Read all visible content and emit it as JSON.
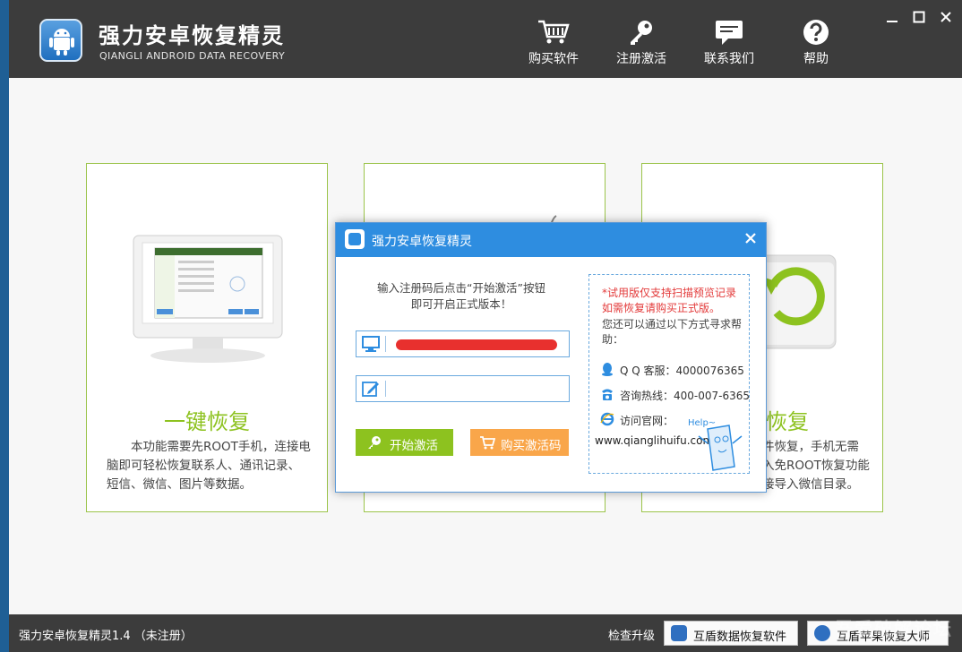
{
  "app": {
    "title": "强力安卓恢复精灵",
    "subtitle": "QIANGLI ANDROID DATA RECOVERY"
  },
  "nav": [
    {
      "label": "购买软件",
      "icon": "cart-icon"
    },
    {
      "label": "注册激活",
      "icon": "key-icon"
    },
    {
      "label": "联系我们",
      "icon": "chat-icon"
    },
    {
      "label": "帮助",
      "icon": "question-icon"
    }
  ],
  "cards": {
    "left": {
      "title": "一键恢复",
      "desc": "本功能需要先ROOT手机，连接电脑即可轻松恢复联系人、通讯记录、短信、微信、图片等数据。"
    },
    "right": {
      "title_visible": "恢复",
      "desc_lines": [
        "件恢复，手机无需",
        "入免ROOT恢复功能",
        "接导入微信目录。"
      ]
    }
  },
  "dialog": {
    "title": "强力安卓恢复精灵",
    "instruction_line1": "输入注册码后点击“开始激活”按钮",
    "instruction_line2": "即可开启正式版本！",
    "activate_label": "开始激活",
    "buy_label": "购买激活码",
    "help_red": "*试用版仅支持扫描预览记录如需恢复请购买正式版。",
    "help_normal": "您还可以通过以下方式寻求帮助：",
    "qq": "Q Q 客服：4000076365",
    "phone": "咨询热线：400-007-6365",
    "site_label": "访问官网：",
    "url": "www.qianglihuifu.com",
    "mascot_text": "Help~"
  },
  "statusbar": {
    "status": "强力安卓恢复精灵1.4 （未注册）",
    "update": "检查升级",
    "btn1": "互盾数据恢复软件",
    "btn2": "互盾苹果恢复大师"
  },
  "watermark": "吾爱破解论坛",
  "colors": {
    "titlebar": "#3c3c3c",
    "accent_green": "#8dc21f",
    "accent_orange": "#f9a64a",
    "dialog_blue": "#2e8de0",
    "help_red": "#e33b3b"
  }
}
